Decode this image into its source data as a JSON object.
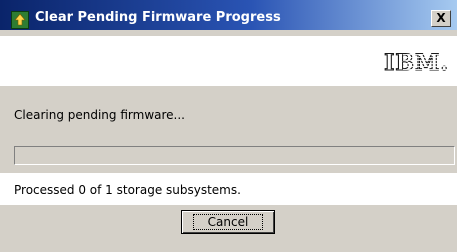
{
  "window": {
    "title": "Clear Pending Firmware Progress",
    "close_label": "X",
    "icon": "app-icon"
  },
  "header": {
    "logo_text": "IBM.",
    "logo_icon": "ibm-logo"
  },
  "main": {
    "status_text": "Clearing pending firmware...",
    "progress_fraction": 0,
    "processed_text": "Processed 0 of 1 storage subsystems."
  },
  "buttons": {
    "cancel_label": "Cancel"
  },
  "colors": {
    "titlebar_start": "#0a246a",
    "titlebar_end": "#a6caf0",
    "face": "#d4d0c8",
    "progress_fill": "#0a246a"
  }
}
